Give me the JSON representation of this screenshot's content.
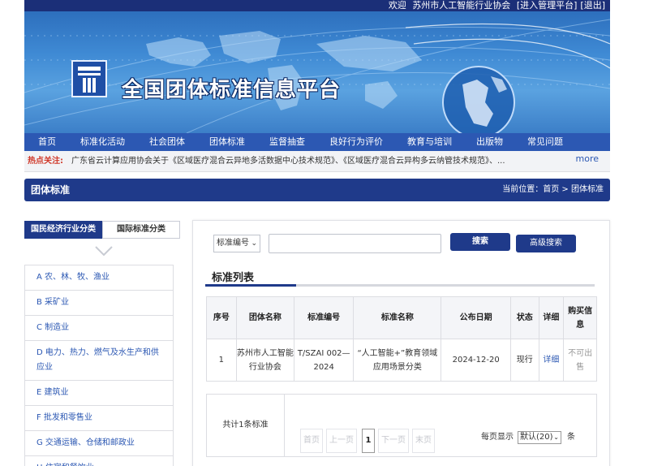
{
  "topbar": {
    "welcome": "欢迎",
    "user": "苏州市人工智能行业协会",
    "admin": "[进入管理平台]",
    "logout": "[退出]"
  },
  "banner": {
    "title": "全国团体标准信息平台"
  },
  "nav": {
    "items": [
      "首页",
      "标准化活动",
      "社会团体",
      "团体标准",
      "监督抽查",
      "良好行为评价",
      "教育与培训",
      "出版物",
      "常见问题"
    ]
  },
  "hot": {
    "label": "热点关注:",
    "text": "广东省云计算应用协会关于《区域医疗混合云异地多活数据中心技术规范》、《区域医疗混合云异构多云纳管技术规范》、...",
    "more": "more"
  },
  "section": {
    "title": "团体标准",
    "crumb_prefix": "当前位置：",
    "crumb_home": "首页",
    "crumb_sep": " > ",
    "crumb_current": "团体标准"
  },
  "sidebar": {
    "tab_active": "国民经济行业分类",
    "tab_other": "国际标准分类",
    "items": [
      "A 农、林、牧、渔业",
      "B 采矿业",
      "C 制造业",
      "D 电力、热力、燃气及水生产和供应业",
      "E 建筑业",
      "F 批发和零售业",
      "G 交通运输、仓储和邮政业",
      "H 住宿和餐饮业"
    ]
  },
  "search": {
    "select_value": "标准编号",
    "input_value": "",
    "search_label": "搜索",
    "advanced_label": "高级搜索"
  },
  "list": {
    "title": "标准列表",
    "columns": [
      "序号",
      "团体名称",
      "标准编号",
      "标准名称",
      "公布日期",
      "状态",
      "详细",
      "购买信息"
    ],
    "rows": [
      {
        "no": "1",
        "org": "苏州市人工智能行业协会",
        "code": "T/SZAI 002—2024",
        "name": "“人工智能+”教育领域应用场景分类",
        "date": "2024-12-20",
        "status": "现行",
        "detail": "详细",
        "buy": "不可出售"
      }
    ]
  },
  "pager": {
    "total": "共计1条标准",
    "first": "首页",
    "prev": "上一页",
    "current": "1",
    "next": "下一页",
    "last": "末页",
    "per_page_label": "每页显示",
    "per_page_value": "默认(20)",
    "unit": "条"
  }
}
